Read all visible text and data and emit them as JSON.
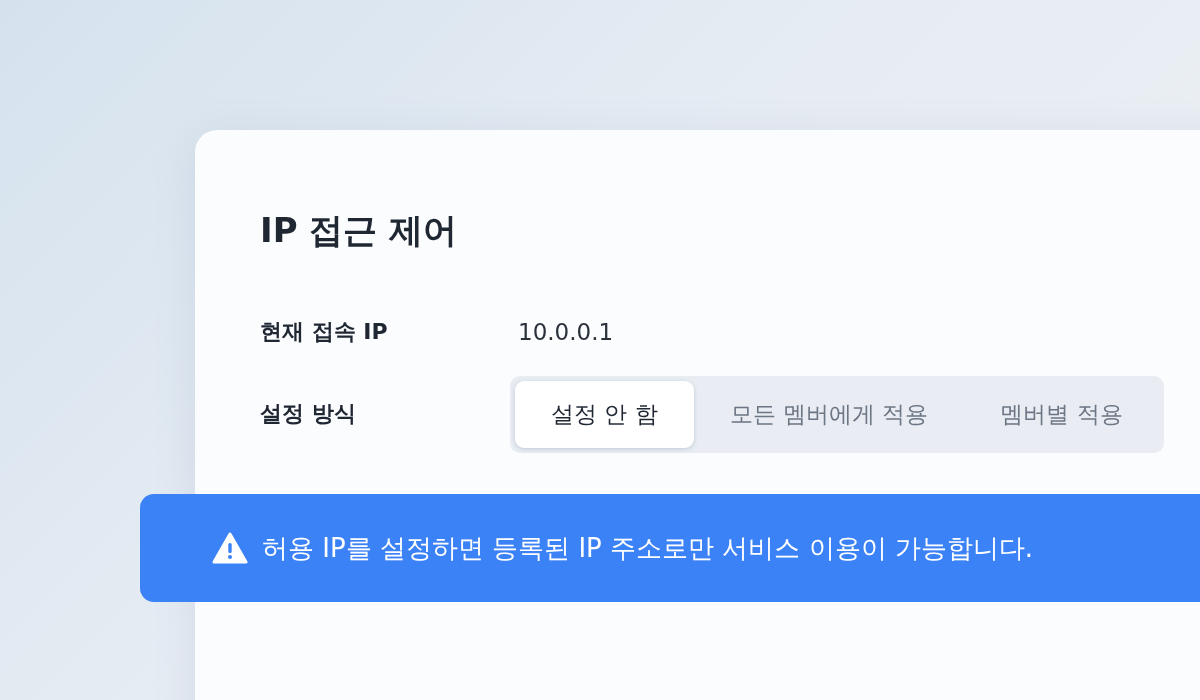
{
  "title": "IP 접근 제어",
  "fields": [
    {
      "label": "현재 접속 IP",
      "value": "10.0.0.1"
    },
    {
      "label": "설정 방식",
      "options": [
        {
          "label": "설정 안 함",
          "selected": true
        },
        {
          "label": "모든 멤버에게 적용",
          "selected": false
        },
        {
          "label": "멤버별 적용",
          "selected": false
        }
      ]
    }
  ],
  "notice": {
    "text": "허용 IP를 설정하면 등록된 IP 주소로만 서비스 이용이 가능합니다."
  }
}
